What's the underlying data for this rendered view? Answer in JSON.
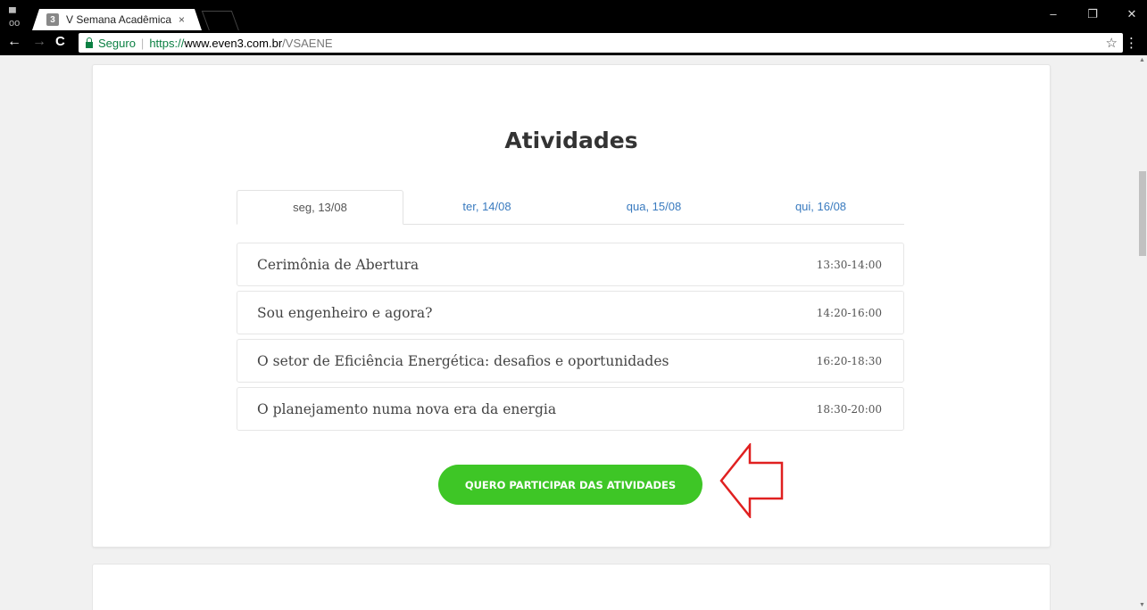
{
  "browser": {
    "tab_title": "V Semana Acadêmica da",
    "tab_favicon": "3",
    "tab_close": "×",
    "secure_label": "Seguro",
    "url_scheme": "https://",
    "url_host": "www.even3.com.br",
    "url_path": "/VSAENE",
    "icons": [
      "back-arrow",
      "forward-arrow",
      "reload",
      "lock",
      "star",
      "menu",
      "minimize",
      "restore",
      "close"
    ]
  },
  "page": {
    "section_title": "Atividades",
    "tabs": [
      {
        "label": "seg, 13/08",
        "active": true
      },
      {
        "label": "ter, 14/08",
        "active": false
      },
      {
        "label": "qua, 15/08",
        "active": false
      },
      {
        "label": "qui, 16/08",
        "active": false
      }
    ],
    "activities": [
      {
        "name": "Cerimônia de Abertura",
        "time": "13:30-14:00"
      },
      {
        "name": "Sou engenheiro e agora?",
        "time": "14:20-16:00"
      },
      {
        "name": "O setor de Eficiência Energética: desafios e oportunidades",
        "time": "16:20-18:30"
      },
      {
        "name": "O planejamento numa nova era da energia",
        "time": "18:30-20:00"
      }
    ],
    "cta_label": "QUERO PARTICIPAR DAS ATIVIDADES",
    "colors": {
      "cta": "#3ec626",
      "tab_link": "#3a7bbf",
      "annotation_arrow": "#e02020"
    }
  }
}
